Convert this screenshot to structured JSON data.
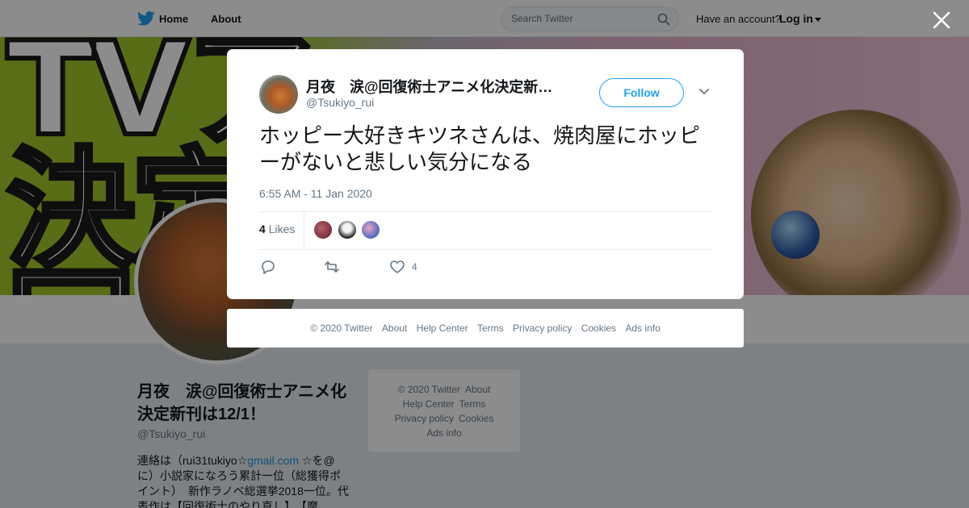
{
  "topbar": {
    "home_label": "Home",
    "about_label": "About",
    "search_placeholder": "Search Twitter",
    "account_prompt": "Have an account?",
    "login_label": "Log in"
  },
  "banner": {
    "visible_text": "TVア\n決定\n回"
  },
  "profile": {
    "name": "月夜　涙@回復術士アニメ化決定新刊は12/1！",
    "handle": "@Tsukiyo_rui",
    "bio_prefix": "連絡は（rui31tukiyo☆",
    "bio_link": "gmail.com",
    "bio_suffix": " ☆を@に）小説家になろう累計一位（総獲得ポイント）　新作ラノベ総選挙2018一位。代表作は【回復術士のやり直し】、【魔"
  },
  "side_footer": {
    "links": [
      "© 2020 Twitter",
      "About",
      "Help Center",
      "Terms",
      "Privacy policy",
      "Cookies",
      "Ads info"
    ]
  },
  "tweet": {
    "author_name": "月夜　涙@回復術士アニメ化決定新刊は12/1！",
    "author_handle": "@Tsukiyo_rui",
    "follow_label": "Follow",
    "text": "ホッピー大好きキツネさんは、焼肉屋にホッピーがないと悲しい気分になる",
    "timestamp": "6:55 AM - 11 Jan 2020",
    "likes_count": "4",
    "likes_label": "Likes",
    "like_action_count": "4"
  },
  "modal_footer": {
    "links": [
      "© 2020 Twitter",
      "About",
      "Help Center",
      "Terms",
      "Privacy policy",
      "Cookies",
      "Ads info"
    ]
  },
  "icons": {
    "brand": "twitter-bird-icon",
    "search": "search-icon",
    "close": "close-icon",
    "reply": "reply-icon",
    "retweet": "retweet-icon",
    "like": "heart-icon",
    "more": "chevron-down-icon"
  },
  "colors": {
    "brand_blue": "#1da1f2",
    "link_blue": "#1b95e0",
    "secondary_text": "#657786",
    "overlay": "rgba(0,0,0,0.45)"
  }
}
